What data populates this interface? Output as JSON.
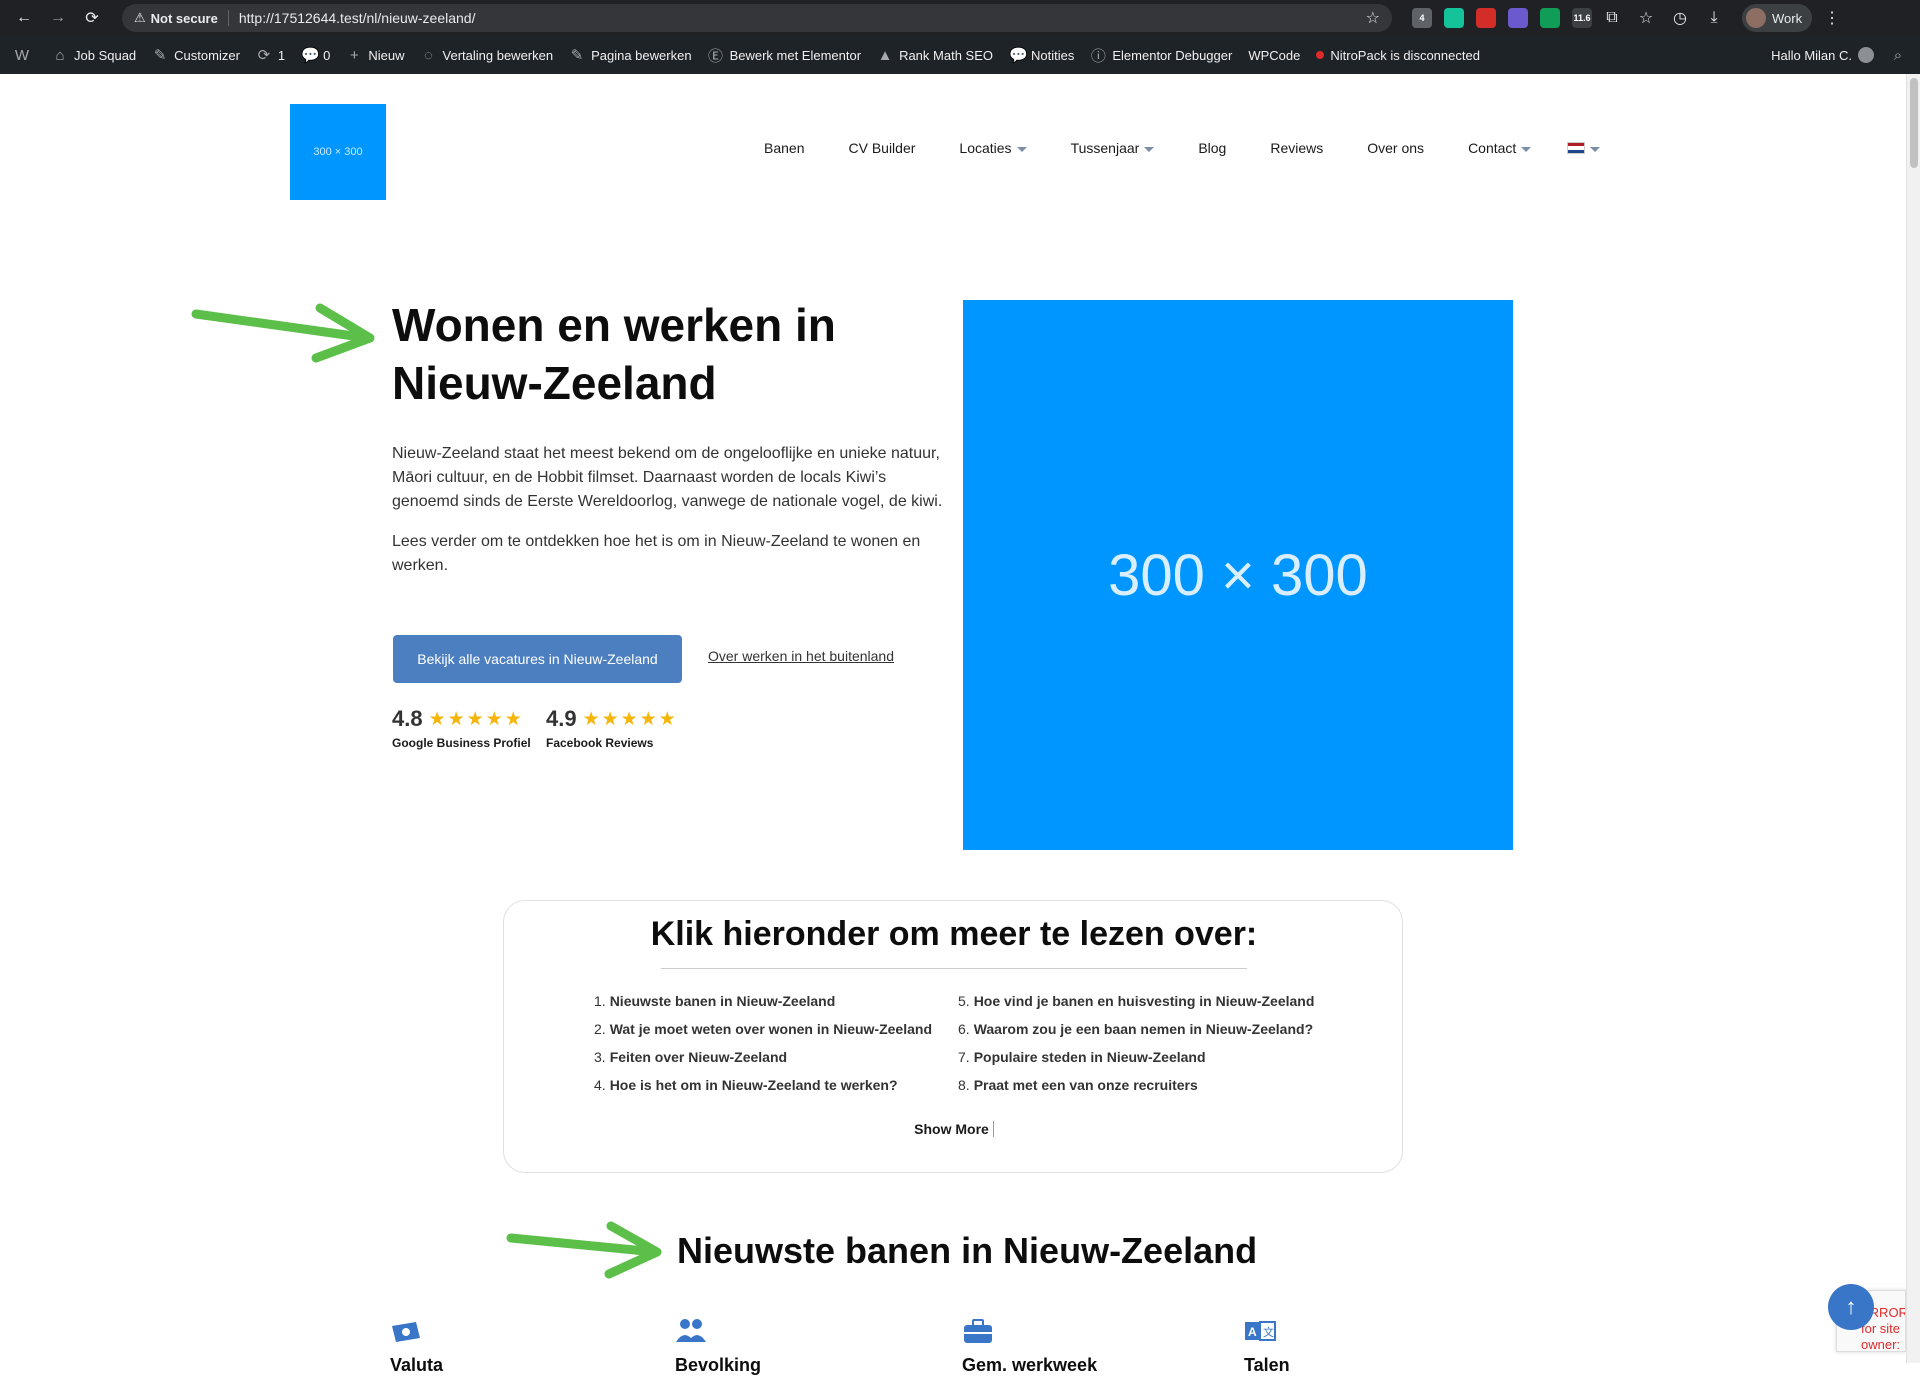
{
  "browser": {
    "security_label": "Not secure",
    "url": "http://17512644.test/nl/nieuw-zeeland/",
    "extensions": [
      {
        "name": "mail-extension-icon",
        "badge": "4",
        "color": "#5f6368"
      },
      {
        "name": "grammarly-icon",
        "badge": "",
        "color": "#15c39a"
      },
      {
        "name": "lastpass-icon",
        "badge": "",
        "color": "#d32d27"
      },
      {
        "name": "extension-purple-icon",
        "badge": "",
        "color": "#6a5acd"
      },
      {
        "name": "extension-green-icon",
        "badge": "",
        "color": "#0f9d58"
      },
      {
        "name": "extension-metric-icon",
        "badge": "11.6",
        "color": "#3c4043"
      }
    ],
    "profile_label": "Work"
  },
  "wp_admin": {
    "items": [
      {
        "name": "wp-logo",
        "label": "",
        "icon": "W"
      },
      {
        "name": "job-squad",
        "label": "Job Squad",
        "icon": "⌂"
      },
      {
        "name": "customizer",
        "label": "Customizer",
        "icon": "✎"
      },
      {
        "name": "updates",
        "label": "1",
        "icon": "⟳"
      },
      {
        "name": "comments",
        "label": "0",
        "icon": "💬"
      },
      {
        "name": "new",
        "label": "Nieuw",
        "icon": "+"
      },
      {
        "name": "translate",
        "label": "Vertaling bewerken",
        "icon": "◌"
      },
      {
        "name": "edit-page",
        "label": "Pagina bewerken",
        "icon": "✎"
      },
      {
        "name": "elementor",
        "label": "Bewerk met Elementor",
        "icon": "Ⓔ"
      },
      {
        "name": "rank-math",
        "label": "Rank Math SEO",
        "icon": "▲"
      },
      {
        "name": "notices",
        "label": "Notities",
        "icon": "💬"
      },
      {
        "name": "elementor-debugger",
        "label": "Elementor Debugger",
        "icon": "ⓘ"
      },
      {
        "name": "wpcode",
        "label": "WPCode",
        "icon": ""
      },
      {
        "name": "nitropack",
        "label": "NitroPack is disconnected",
        "icon": "dot"
      }
    ],
    "greeting": "Hallo Milan C."
  },
  "site": {
    "logo_text": "300 × 300",
    "nav": [
      {
        "label": "Banen",
        "dropdown": false
      },
      {
        "label": "CV Builder",
        "dropdown": false
      },
      {
        "label": "Locaties",
        "dropdown": true
      },
      {
        "label": "Tussenjaar",
        "dropdown": true
      },
      {
        "label": "Blog",
        "dropdown": false
      },
      {
        "label": "Reviews",
        "dropdown": false
      },
      {
        "label": "Over ons",
        "dropdown": false
      },
      {
        "label": "Contact",
        "dropdown": true
      }
    ]
  },
  "hero": {
    "title": "Wonen en werken in Nieuw-Zeeland",
    "paragraph_1": "Nieuw-Zeeland staat het meest bekend om de ongelooflijke en unieke natuur, Māori cultuur, en de Hobbit filmset. Daarnaast worden de locals Kiwi’s genoemd sinds de Eerste Wereldoorlog, vanwege de nationale vogel, de kiwi.",
    "paragraph_2": "Lees verder om te ontdekken hoe het is om in Nieuw-Zeeland te wonen en werken.",
    "cta_label": "Bekijk alle vacatures in Nieuw-Zeeland",
    "secondary_link": "Over werken in het buitenland",
    "ratings": [
      {
        "score": "4.8",
        "label": "Google Business Profiel",
        "stars": 5
      },
      {
        "score": "4.9",
        "label": "Facebook Reviews",
        "stars": 5
      }
    ],
    "image_text": "300 × 300"
  },
  "toc": {
    "title": "Klik hieronder om meer te lezen over:",
    "items": [
      "Nieuwste banen in Nieuw-Zeeland",
      "Wat je moet weten over wonen in Nieuw-Zeeland",
      "Feiten over Nieuw-Zeeland",
      "Hoe is het om in Nieuw-Zeeland te werken?",
      "Hoe vind je banen en huisvesting in Nieuw-Zeeland",
      "Waarom zou je een baan nemen in Nieuw-Zeeland?",
      "Populaire steden in Nieuw-Zeeland",
      "Praat met een van onze recruiters"
    ],
    "show_more": "Show More"
  },
  "section": {
    "title": "Nieuwste banen in Nieuw-Zeeland",
    "info": [
      {
        "label": "Valuta",
        "icon": "money-icon"
      },
      {
        "label": "Bevolking",
        "icon": "people-icon"
      },
      {
        "label": "Gem. werkweek",
        "icon": "briefcase-icon"
      },
      {
        "label": "Talen",
        "icon": "translate-icon"
      }
    ]
  },
  "recaptcha": {
    "text": "ERROR for site owner: Invalid domain"
  },
  "colors": {
    "accent": "#4c7fc0",
    "placeholder": "#0096ff",
    "arrow": "#5cbf4a",
    "star": "#f5b50a"
  }
}
